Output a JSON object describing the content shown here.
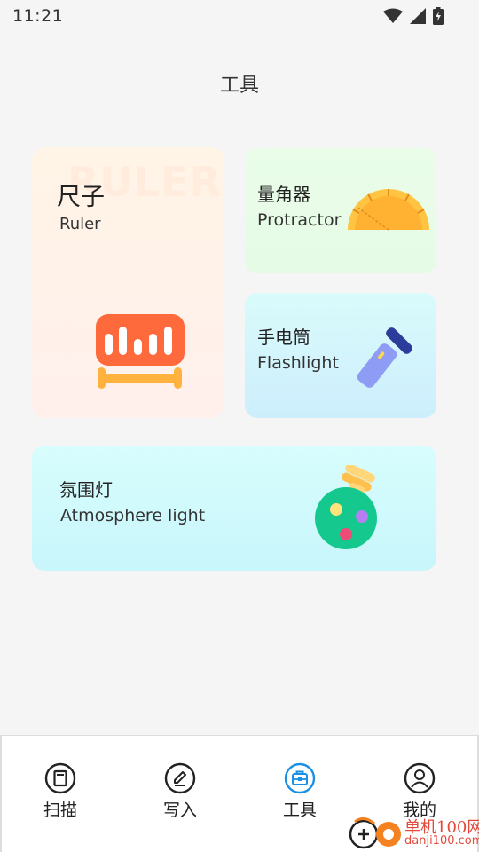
{
  "status_bar": {
    "time": "11:21",
    "icons": [
      "wifi-icon",
      "signal-icon",
      "battery-charging-icon"
    ]
  },
  "header": {
    "title": "工具"
  },
  "tools": {
    "ruler": {
      "title_cn": "尺子",
      "title_en": "Ruler",
      "watermark": "RULER"
    },
    "protractor": {
      "title_cn": "量角器",
      "title_en": "Protractor"
    },
    "flashlight": {
      "title_cn": "手电筒",
      "title_en": "Flashlight"
    },
    "atmosphere": {
      "title_cn": "氛围灯",
      "title_en": "Atmosphere light"
    }
  },
  "bottom_nav": [
    {
      "label": "扫描",
      "icon": "scan-icon"
    },
    {
      "label": "写入",
      "icon": "write-icon"
    },
    {
      "label": "工具",
      "icon": "toolbox-icon",
      "active": true
    },
    {
      "label": "我的",
      "icon": "profile-icon"
    }
  ],
  "watermark": {
    "cn": "单机100网",
    "en": "danji100.com"
  },
  "colors": {
    "accent": "#1a8fe6",
    "ruler_orange": "#ff6a3d",
    "protractor_yellow": "#ffc542",
    "flashlight_purple": "#8f9cf5",
    "atmosphere_green": "#15c88e"
  }
}
